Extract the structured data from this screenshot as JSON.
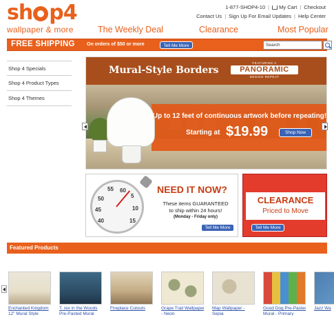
{
  "logo": {
    "word": "shop4",
    "tagline": "wallpaper & more"
  },
  "toplinks": {
    "phone": "1-877-SHOP4-10",
    "cart": "My Cart",
    "checkout": "Checkout",
    "contact": "Contact Us",
    "signup": "Sign Up For Email Updates",
    "help": "Help Center"
  },
  "nav": {
    "weekly": "The Weekly Deal",
    "clearance": "Clearance",
    "popular": "Most Popular"
  },
  "shipbar": {
    "title": "FREE SHIPPING",
    "orders": "On orders of $50 or more",
    "tell_me": "Tell Me More",
    "search_value": "Search"
  },
  "sidebar": {
    "items": [
      {
        "label": "Shop 4 Specials"
      },
      {
        "label": "Shop 4 Product Types"
      },
      {
        "label": "Shop 4 Themes"
      }
    ]
  },
  "hero": {
    "title": "Mural-Style Borders",
    "featuring": "FEATURING A",
    "panoramic": "PANORAMIC",
    "design_repeat": "DESIGN REPEAT",
    "headline": "Up to 12 feet of continuous artwork before repeating!",
    "starting": "Starting at",
    "price": "$19.99",
    "shop_now": "Shop Now"
  },
  "promo_need": {
    "title": "NEED IT NOW?",
    "line1": "These items GUARANTEED",
    "line2": "to ship within 24 hours!",
    "small": "(Monday - Friday only)",
    "button": "Tell Me More",
    "dial": [
      "55",
      "60",
      "5",
      "50",
      "10",
      "45",
      "15",
      "40"
    ]
  },
  "promo_clearance": {
    "title": "CLEARANCE",
    "sub": "Priced to Move",
    "button": "Tell Me More"
  },
  "featured": {
    "heading": "Featured Products",
    "items": [
      {
        "name": "Enchanted Kingdom",
        "name2": "12\" Mural Style",
        "color": "#e9e4d4"
      },
      {
        "name": "T. rex in the Woods",
        "name2": "Pre-Pasted Mural",
        "color": "#2f4e66"
      },
      {
        "name": "Fireplace Cutouts",
        "name2": "",
        "color": "#c9b28a"
      },
      {
        "name": "Grape Trail Wallpaper",
        "name2": "- Neon",
        "color": "#efe8d2"
      },
      {
        "name": "Map Wallpaper -",
        "name2": "Sepia",
        "color": "#e5dfcf"
      },
      {
        "name": "Good Dog Pre-Pasted",
        "name2": "Mural - Primary",
        "color": "#d6c24a"
      },
      {
        "name": "Jazz Wa",
        "name2": "",
        "color": "#4d7fb0"
      }
    ]
  },
  "colors": {
    "brand": "#e8601c",
    "button": "#3a63b5",
    "clearance": "#e33b2c"
  }
}
